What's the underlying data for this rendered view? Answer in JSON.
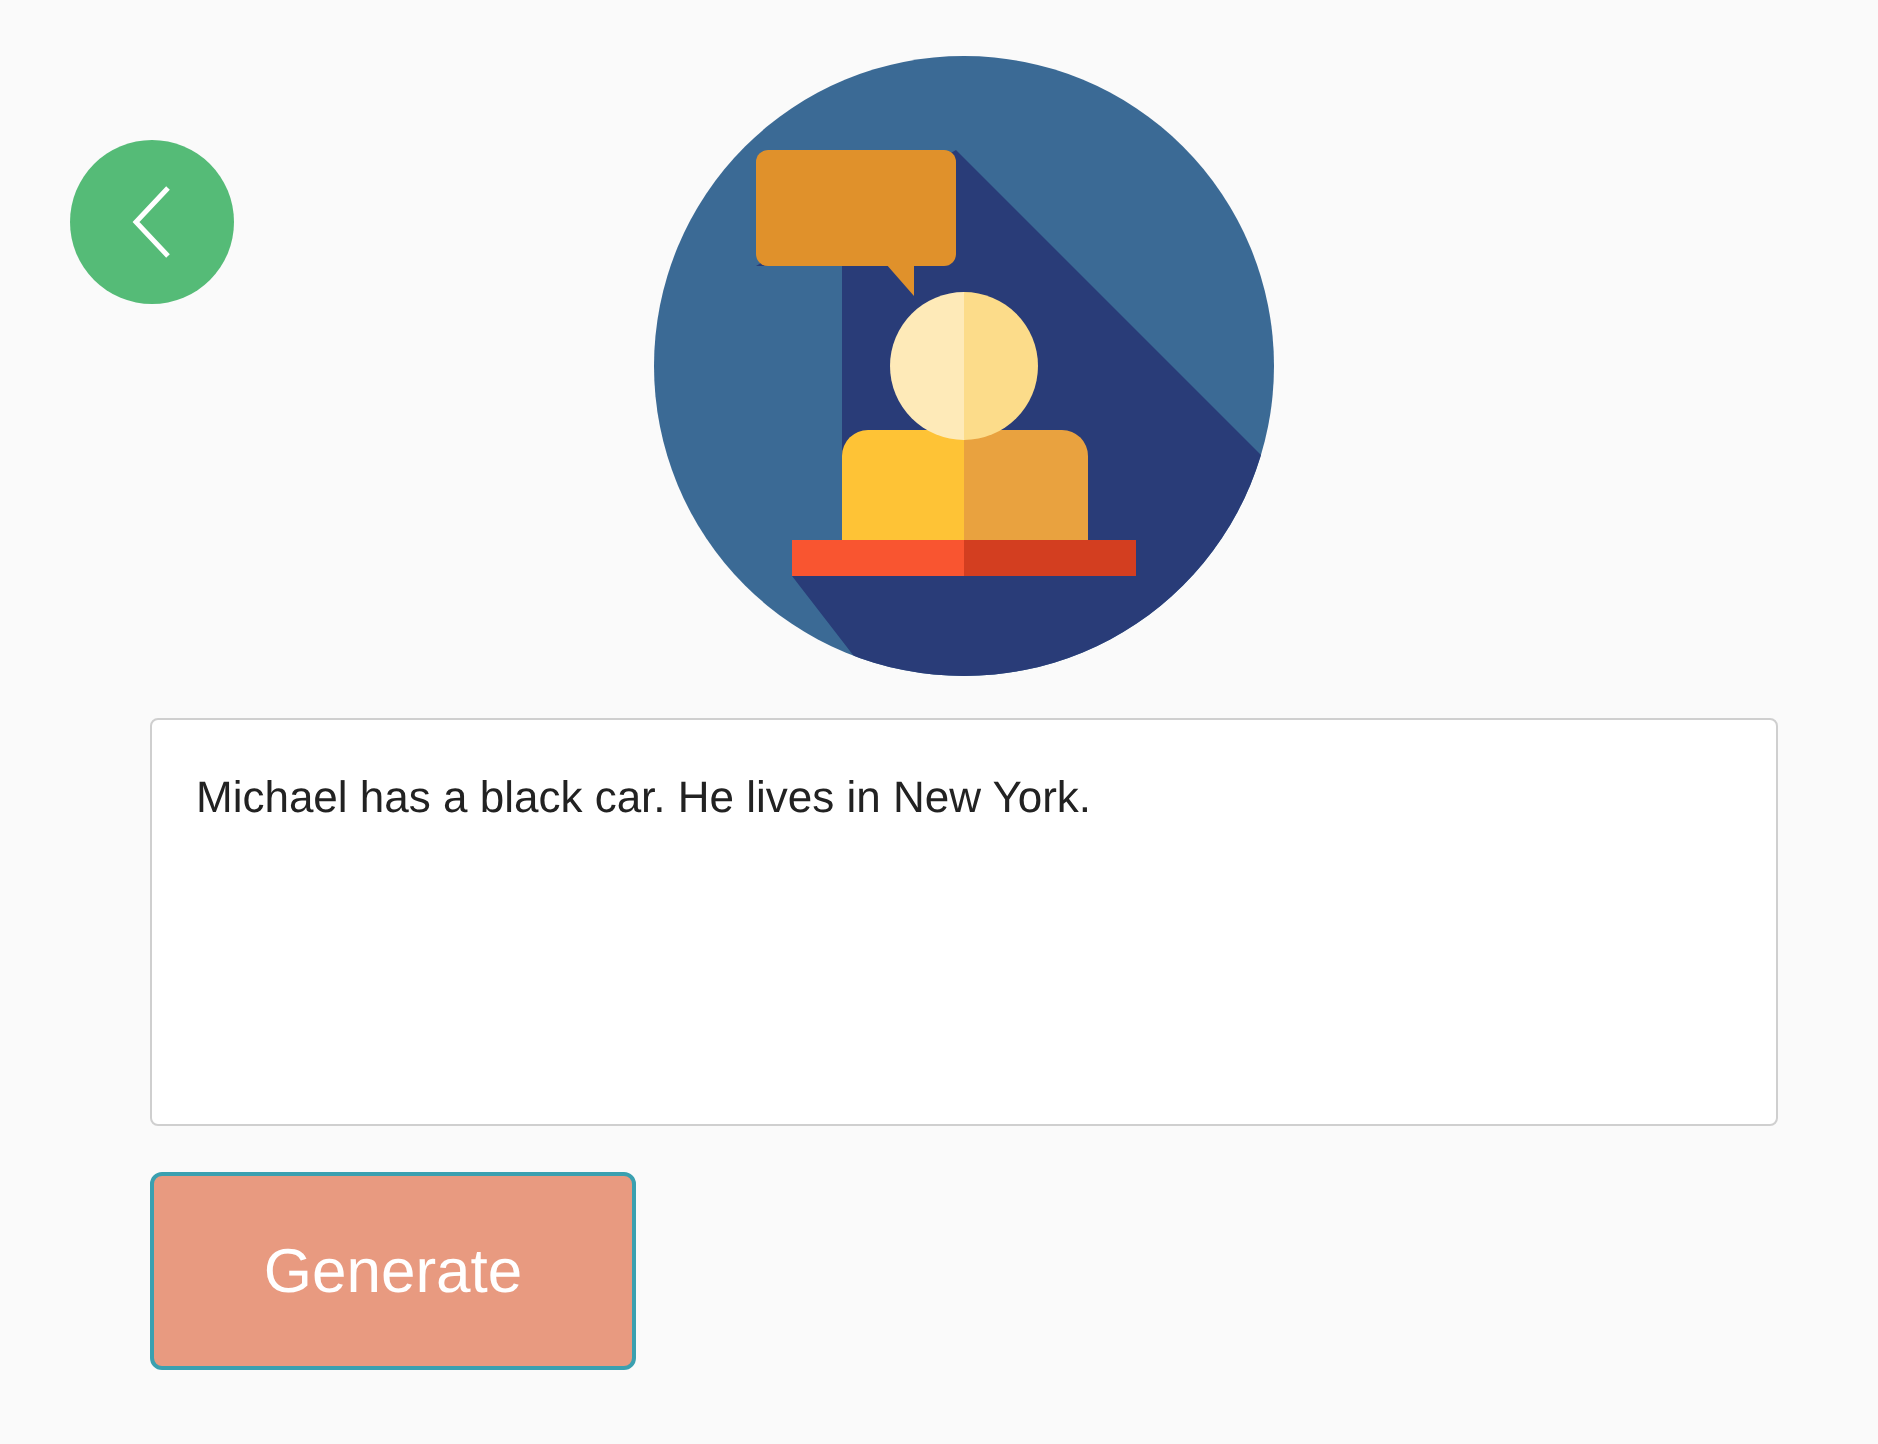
{
  "text_input": {
    "value": "Michael has a black car. He lives in New York."
  },
  "buttons": [
    {
      "label": "Generate",
      "focused": true
    }
  ]
}
